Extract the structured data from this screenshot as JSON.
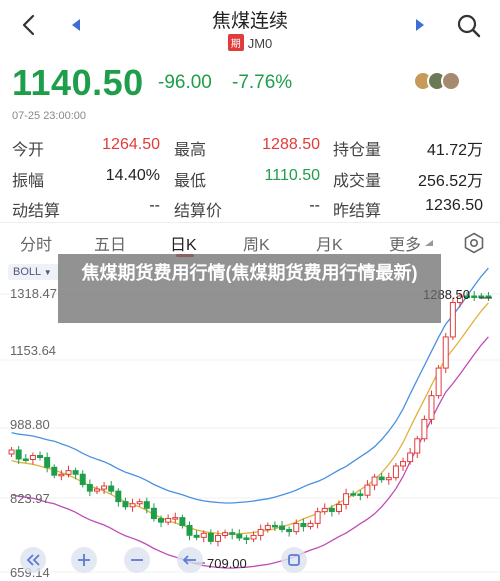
{
  "header": {
    "title": "焦煤连续",
    "badge": "期",
    "code": "JM0"
  },
  "quote": {
    "price": "1140.50",
    "change": "-96.00",
    "change_pct": "-7.76%",
    "timestamp": "07-25 23:00:00"
  },
  "stats": [
    [
      {
        "label": "今开",
        "value": "1264.50",
        "color": "red"
      },
      {
        "label": "最高",
        "value": "1288.50",
        "color": "red"
      },
      {
        "label": "持仓量",
        "value": "41.72万",
        "color": "black"
      }
    ],
    [
      {
        "label": "振幅",
        "value": "14.40%",
        "color": "black"
      },
      {
        "label": "最低",
        "value": "1110.50",
        "color": "green"
      },
      {
        "label": "成交量",
        "value": "256.52万",
        "color": "black"
      }
    ],
    [
      {
        "label": "动结算",
        "value": "--",
        "color": "black"
      },
      {
        "label": "结算价",
        "value": "--",
        "color": "black"
      },
      {
        "label": "昨结算",
        "value": "1236.50",
        "color": "black"
      }
    ]
  ],
  "tabs": [
    "分时",
    "五日",
    "日K",
    "周K",
    "月K",
    "更多"
  ],
  "active_tab": "日K",
  "chart": {
    "indicator": "BOLL",
    "y_labels": [
      "1318.47",
      "1153.64",
      "988.80",
      "823.97",
      "659.14"
    ],
    "high_callout": "1288.50",
    "low_callout": "709.00"
  },
  "overlay": {
    "text": "焦煤期货费用行情(焦煤期货费用行情最新)"
  },
  "colors": {
    "up": "#e23b3b",
    "down": "#1e9e4a",
    "boll_mid": "#e0b23a",
    "boll_upper": "#4a90e2",
    "boll_lower": "#c04bb8"
  },
  "icons": {
    "back": "chevron-left-icon",
    "prev": "triangle-left-icon",
    "next": "triangle-right-icon",
    "search": "search-icon",
    "settings": "hexagon-settings-icon"
  }
}
